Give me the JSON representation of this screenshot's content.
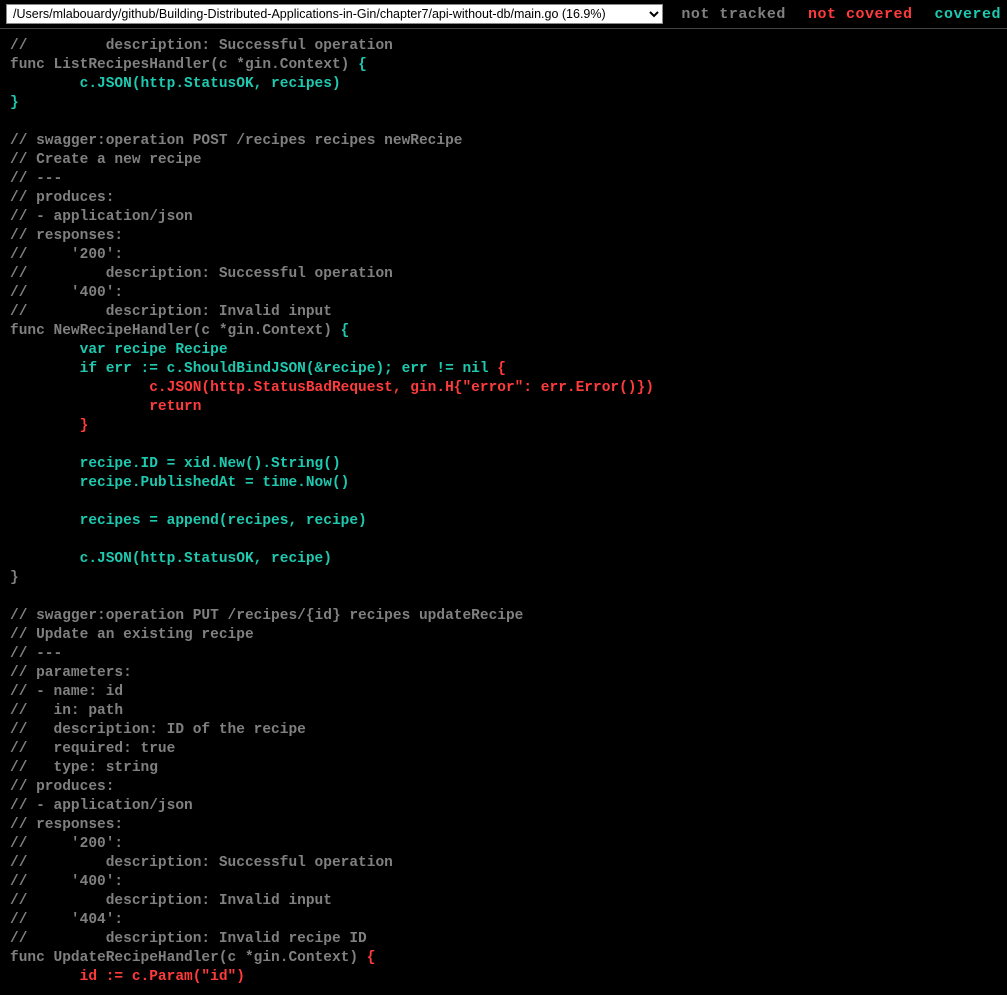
{
  "topbar": {
    "file_path": "/Users/mlabouardy/github/Building-Distributed-Applications-in-Gin/chapter7/api-without-db/main.go (16.9%)",
    "legend": {
      "not_tracked": "not tracked",
      "not_covered": "not covered",
      "covered": "covered"
    }
  },
  "code": {
    "l01": "//         description: Successful operation",
    "l02a": "func ListRecipesHandler(c *gin.Context) ",
    "l02b": "{",
    "l03": "        c.JSON(http.StatusOK, recipes)",
    "l04": "}",
    "l05": "",
    "l06": "// swagger:operation POST /recipes recipes newRecipe",
    "l07": "// Create a new recipe",
    "l08": "// ---",
    "l09": "// produces:",
    "l10": "// - application/json",
    "l11": "// responses:",
    "l12": "//     '200':",
    "l13": "//         description: Successful operation",
    "l14": "//     '400':",
    "l15": "//         description: Invalid input",
    "l16a": "func NewRecipeHandler(c *gin.Context) ",
    "l16b": "{",
    "l17": "        var recipe Recipe",
    "l18a": "        if err := c.ShouldBindJSON(&recipe); err != nil ",
    "l18b": "{",
    "l19": "                c.JSON(http.StatusBadRequest, gin.H{\"error\": err.Error()})",
    "l20": "                return",
    "l21": "        }",
    "l22": "",
    "l23": "        recipe.ID = xid.New().String()",
    "l24": "        recipe.PublishedAt = time.Now()",
    "l25": "",
    "l26": "        recipes = append(recipes, recipe)",
    "l27": "",
    "l28": "        c.JSON(http.StatusOK, recipe)",
    "l29": "}",
    "l30": "",
    "l31": "// swagger:operation PUT /recipes/{id} recipes updateRecipe",
    "l32": "// Update an existing recipe",
    "l33": "// ---",
    "l34": "// parameters:",
    "l35": "// - name: id",
    "l36": "//   in: path",
    "l37": "//   description: ID of the recipe",
    "l38": "//   required: true",
    "l39": "//   type: string",
    "l40": "// produces:",
    "l41": "// - application/json",
    "l42": "// responses:",
    "l43": "//     '200':",
    "l44": "//         description: Successful operation",
    "l45": "//     '400':",
    "l46": "//         description: Invalid input",
    "l47": "//     '404':",
    "l48": "//         description: Invalid recipe ID",
    "l49a": "func UpdateRecipeHandler(c *gin.Context) ",
    "l49b": "{",
    "l50": "        id := c.Param(\"id\")"
  }
}
